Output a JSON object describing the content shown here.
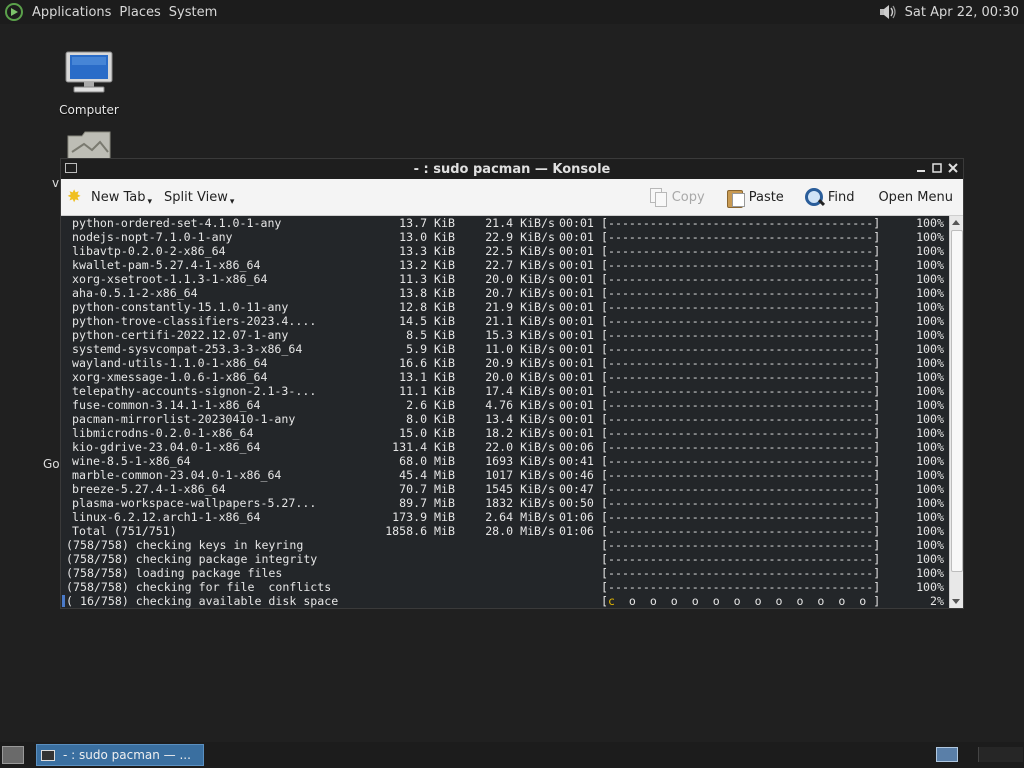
{
  "top_panel": {
    "menus": [
      "Applications",
      "Places",
      "System"
    ],
    "clock": "Sat Apr 22, 00:30"
  },
  "desktop": {
    "icons": [
      {
        "label": "Computer"
      },
      {
        "label": ""
      }
    ],
    "edge_labels": {
      "v": "v",
      "go": "Go"
    }
  },
  "window": {
    "title": "- : sudo pacman — Konsole",
    "toolbar": {
      "new_tab": "New Tab",
      "split_view": "Split View",
      "copy": "Copy",
      "paste": "Paste",
      "find": "Find",
      "open_menu": "Open Menu"
    }
  },
  "terminal": {
    "downloads": [
      {
        "name": "python-ordered-set-4.1.0-1-any",
        "size": "13.7 KiB",
        "rate": "21.4 KiB/s",
        "time": "00:01",
        "bar": "[--------------------------------------]",
        "pct": "100%"
      },
      {
        "name": "nodejs-nopt-7.1.0-1-any",
        "size": "13.0 KiB",
        "rate": "22.9 KiB/s",
        "time": "00:01",
        "bar": "[--------------------------------------]",
        "pct": "100%"
      },
      {
        "name": "libavtp-0.2.0-2-x86_64",
        "size": "13.3 KiB",
        "rate": "22.5 KiB/s",
        "time": "00:01",
        "bar": "[--------------------------------------]",
        "pct": "100%"
      },
      {
        "name": "kwallet-pam-5.27.4-1-x86_64",
        "size": "13.2 KiB",
        "rate": "22.7 KiB/s",
        "time": "00:01",
        "bar": "[--------------------------------------]",
        "pct": "100%"
      },
      {
        "name": "xorg-xsetroot-1.1.3-1-x86_64",
        "size": "11.3 KiB",
        "rate": "20.0 KiB/s",
        "time": "00:01",
        "bar": "[--------------------------------------]",
        "pct": "100%"
      },
      {
        "name": "aha-0.5.1-2-x86_64",
        "size": "13.8 KiB",
        "rate": "20.7 KiB/s",
        "time": "00:01",
        "bar": "[--------------------------------------]",
        "pct": "100%"
      },
      {
        "name": "python-constantly-15.1.0-11-any",
        "size": "12.8 KiB",
        "rate": "21.9 KiB/s",
        "time": "00:01",
        "bar": "[--------------------------------------]",
        "pct": "100%"
      },
      {
        "name": "python-trove-classifiers-2023.4....",
        "size": "14.5 KiB",
        "rate": "21.1 KiB/s",
        "time": "00:01",
        "bar": "[--------------------------------------]",
        "pct": "100%"
      },
      {
        "name": "python-certifi-2022.12.07-1-any",
        "size": "8.5 KiB",
        "rate": "15.3 KiB/s",
        "time": "00:01",
        "bar": "[--------------------------------------]",
        "pct": "100%"
      },
      {
        "name": "systemd-sysvcompat-253.3-3-x86_64",
        "size": "5.9 KiB",
        "rate": "11.0 KiB/s",
        "time": "00:01",
        "bar": "[--------------------------------------]",
        "pct": "100%"
      },
      {
        "name": "wayland-utils-1.1.0-1-x86_64",
        "size": "16.6 KiB",
        "rate": "20.9 KiB/s",
        "time": "00:01",
        "bar": "[--------------------------------------]",
        "pct": "100%"
      },
      {
        "name": "xorg-xmessage-1.0.6-1-x86_64",
        "size": "13.1 KiB",
        "rate": "20.0 KiB/s",
        "time": "00:01",
        "bar": "[--------------------------------------]",
        "pct": "100%"
      },
      {
        "name": "telepathy-accounts-signon-2.1-3-...",
        "size": "11.1 KiB",
        "rate": "17.4 KiB/s",
        "time": "00:01",
        "bar": "[--------------------------------------]",
        "pct": "100%"
      },
      {
        "name": "fuse-common-3.14.1-1-x86_64",
        "size": "2.6 KiB",
        "rate": "4.76 KiB/s",
        "time": "00:01",
        "bar": "[--------------------------------------]",
        "pct": "100%"
      },
      {
        "name": "pacman-mirrorlist-20230410-1-any",
        "size": "8.0 KiB",
        "rate": "13.4 KiB/s",
        "time": "00:01",
        "bar": "[--------------------------------------]",
        "pct": "100%"
      },
      {
        "name": "libmicrodns-0.2.0-1-x86_64",
        "size": "15.0 KiB",
        "rate": "18.2 KiB/s",
        "time": "00:01",
        "bar": "[--------------------------------------]",
        "pct": "100%"
      },
      {
        "name": "kio-gdrive-23.04.0-1-x86_64",
        "size": "131.4 KiB",
        "rate": "22.0 KiB/s",
        "time": "00:06",
        "bar": "[--------------------------------------]",
        "pct": "100%"
      },
      {
        "name": "wine-8.5-1-x86_64",
        "size": "68.0 MiB",
        "rate": "1693 KiB/s",
        "time": "00:41",
        "bar": "[--------------------------------------]",
        "pct": "100%"
      },
      {
        "name": "marble-common-23.04.0-1-x86_64",
        "size": "45.4 MiB",
        "rate": "1017 KiB/s",
        "time": "00:46",
        "bar": "[--------------------------------------]",
        "pct": "100%"
      },
      {
        "name": "breeze-5.27.4-1-x86_64",
        "size": "70.7 MiB",
        "rate": "1545 KiB/s",
        "time": "00:47",
        "bar": "[--------------------------------------]",
        "pct": "100%"
      },
      {
        "name": "plasma-workspace-wallpapers-5.27...",
        "size": "89.7 MiB",
        "rate": "1832 KiB/s",
        "time": "00:50",
        "bar": "[--------------------------------------]",
        "pct": "100%"
      },
      {
        "name": "linux-6.2.12.arch1-1-x86_64",
        "size": "173.9 MiB",
        "rate": "2.64 MiB/s",
        "time": "01:06",
        "bar": "[--------------------------------------]",
        "pct": "100%"
      },
      {
        "name": "Total (751/751)",
        "size": "1858.6 MiB",
        "rate": "28.0 MiB/s",
        "time": "01:06",
        "bar": "[--------------------------------------]",
        "pct": "100%"
      }
    ],
    "checks": [
      {
        "text": "(758/758) checking keys in keyring",
        "bar": "[--------------------------------------]",
        "pct": "100%"
      },
      {
        "text": "(758/758) checking package integrity",
        "bar": "[--------------------------------------]",
        "pct": "100%"
      },
      {
        "text": "(758/758) loading package files",
        "bar": "[--------------------------------------]",
        "pct": "100%"
      },
      {
        "text": "(758/758) checking for file  conflicts",
        "bar": "[--------------------------------------]",
        "pct": "100%"
      }
    ],
    "current": {
      "text": "( 16/758) checking available disk space",
      "bar_open": "[",
      "pacman": "c",
      "dots": "  o  o  o  o  o  o  o  o  o  o  o  o ",
      "bar_close": "]",
      "pct": "2%",
      "progress": 0.02
    }
  },
  "bottom_panel": {
    "task_label": "- : sudo pacman — ..."
  },
  "colors": {
    "terminal_bg": "#232629",
    "pacman_yellow": "#e6b800",
    "task_active": "#3a6fa0"
  }
}
